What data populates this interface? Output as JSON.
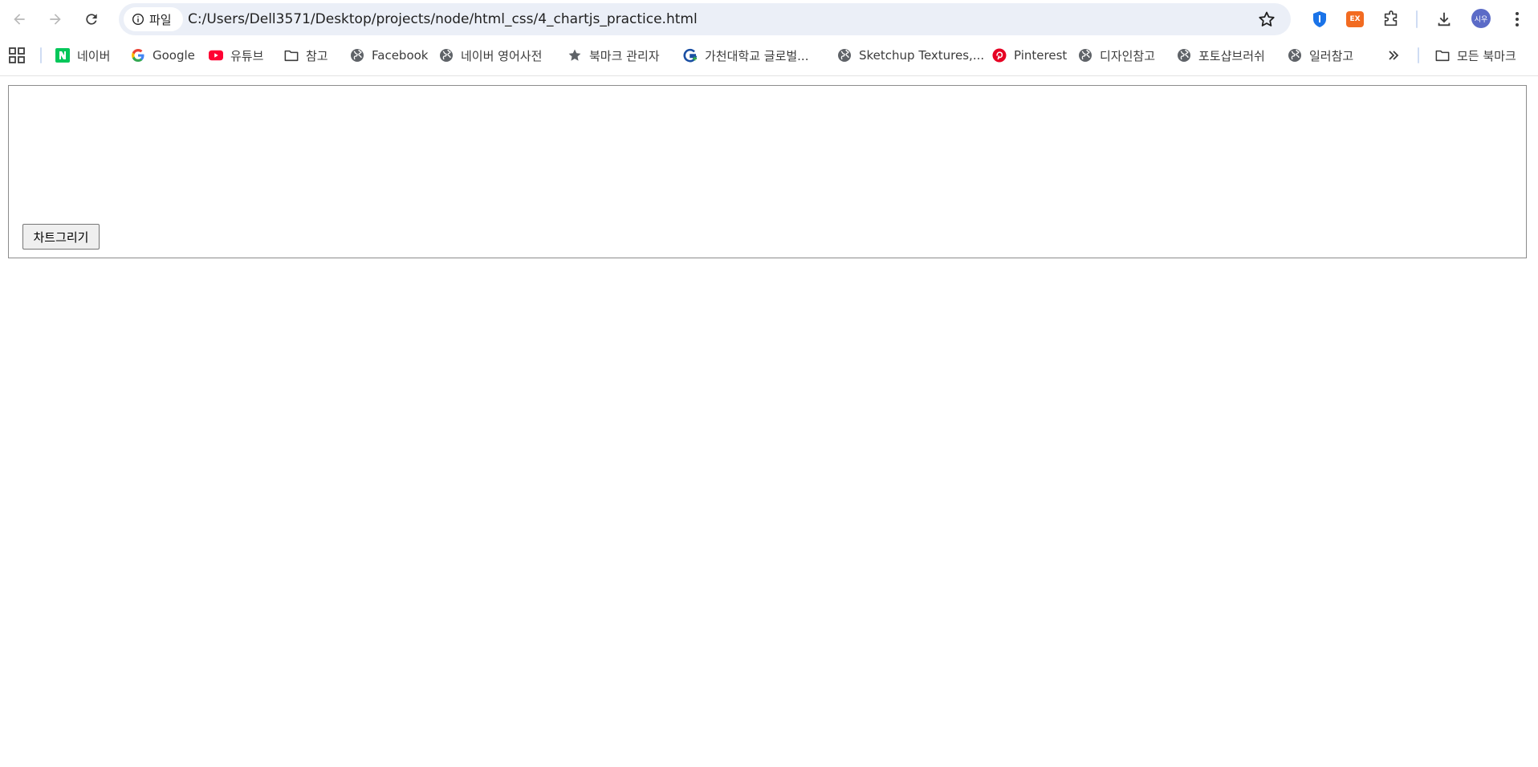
{
  "browser": {
    "site_chip_label": "파일",
    "url": "C:/Users/Dell3571/Desktop/projects/node/html_css/4_chartjs_practice.html",
    "avatar_text": "시우",
    "ext_orange_label": "EX",
    "icons": {
      "back": "arrow-left-icon",
      "forward": "arrow-right-icon",
      "reload": "reload-icon",
      "info": "info-icon",
      "bookmark": "star-outline-icon",
      "password_manager": "shield-icon",
      "extension_ex": "ex-extension-icon",
      "extensions": "puzzle-icon",
      "downloads": "download-icon",
      "menu": "kebab-menu-icon"
    }
  },
  "bookmarks": {
    "items": [
      {
        "label": "네이버",
        "icon": "naver-icon"
      },
      {
        "label": "Google",
        "icon": "google-icon"
      },
      {
        "label": "유튜브",
        "icon": "youtube-icon"
      },
      {
        "label": "참고",
        "icon": "folder-icon"
      },
      {
        "label": "Facebook",
        "icon": "globe-icon"
      },
      {
        "label": "네이버 영어사전",
        "icon": "globe-icon"
      },
      {
        "label": "북마크 관리자",
        "icon": "star-icon"
      },
      {
        "label": "가천대학교 글로벌...",
        "icon": "gachon-icon"
      },
      {
        "label": "Sketchup Textures,...",
        "icon": "globe-icon"
      },
      {
        "label": "Pinterest",
        "icon": "pinterest-icon"
      },
      {
        "label": "디자인참고",
        "icon": "globe-icon"
      },
      {
        "label": "포토샵브러쉬",
        "icon": "globe-icon"
      },
      {
        "label": "일러참고",
        "icon": "globe-icon"
      }
    ],
    "all_bookmarks_label": "모든 북마크"
  },
  "page": {
    "draw_chart_button": "차트그리기"
  },
  "colors": {
    "omnibox_bg": "#ebeff7",
    "naver_green": "#03c75a",
    "youtube_red": "#ff0033",
    "pinterest_red": "#e60023",
    "shield_blue": "#1a73e8",
    "ex_orange": "#f26b21",
    "avatar_bg": "#5b6bc7"
  }
}
